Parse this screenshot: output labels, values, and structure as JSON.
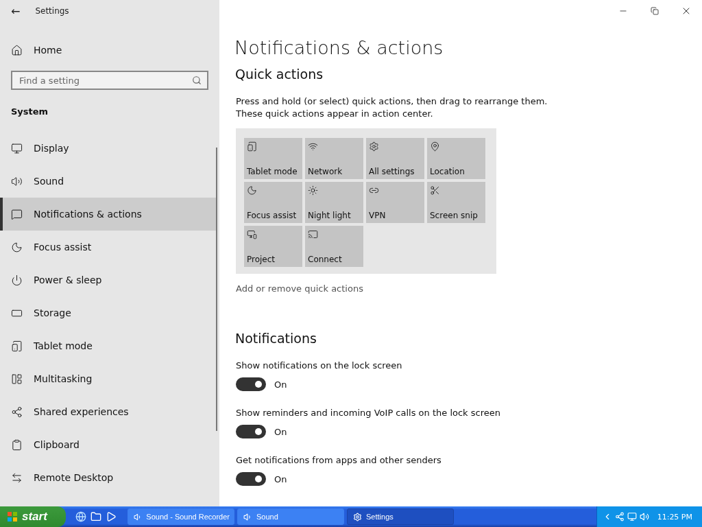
{
  "window": {
    "title": "Settings",
    "back": "←"
  },
  "sidebar": {
    "home": "Home",
    "search": {
      "placeholder": "Find a setting"
    },
    "section": "System",
    "items": [
      {
        "label": "Display",
        "selected": false
      },
      {
        "label": "Sound",
        "selected": false
      },
      {
        "label": "Notifications & actions",
        "selected": true
      },
      {
        "label": "Focus assist",
        "selected": false
      },
      {
        "label": "Power & sleep",
        "selected": false
      },
      {
        "label": "Storage",
        "selected": false
      },
      {
        "label": "Tablet mode",
        "selected": false
      },
      {
        "label": "Multitasking",
        "selected": false
      },
      {
        "label": "Shared experiences",
        "selected": false
      },
      {
        "label": "Clipboard",
        "selected": false
      },
      {
        "label": "Remote Desktop",
        "selected": false
      }
    ]
  },
  "page": {
    "title": "Notifications & actions",
    "quick_actions": {
      "heading": "Quick actions",
      "description": [
        "Press and hold (or select) quick actions, then drag to rearrange them.",
        "These quick actions appear in action center."
      ],
      "tiles": [
        {
          "label": "Tablet mode"
        },
        {
          "label": "Network"
        },
        {
          "label": "All settings"
        },
        {
          "label": "Location"
        },
        {
          "label": "Focus assist"
        },
        {
          "label": "Night light"
        },
        {
          "label": "VPN"
        },
        {
          "label": "Screen snip"
        },
        {
          "label": "Project"
        },
        {
          "label": "Connect"
        }
      ],
      "link": "Add or remove quick actions"
    },
    "notifications": {
      "heading": "Notifications",
      "items": [
        {
          "label": "Show notifications on the lock screen",
          "on": true,
          "state": "On"
        },
        {
          "label": "Show reminders and incoming VoIP calls on the lock screen",
          "on": true,
          "state": "On"
        },
        {
          "label": "Get notifications from apps and other senders",
          "on": true,
          "state": "On"
        }
      ]
    }
  },
  "taskbar": {
    "start": "start",
    "tasks": [
      {
        "label": "Sound - Sound Recorder",
        "selected": false
      },
      {
        "label": "Sound",
        "selected": false
      },
      {
        "label": "Settings",
        "selected": true
      }
    ],
    "clock": "11:25 PM"
  }
}
